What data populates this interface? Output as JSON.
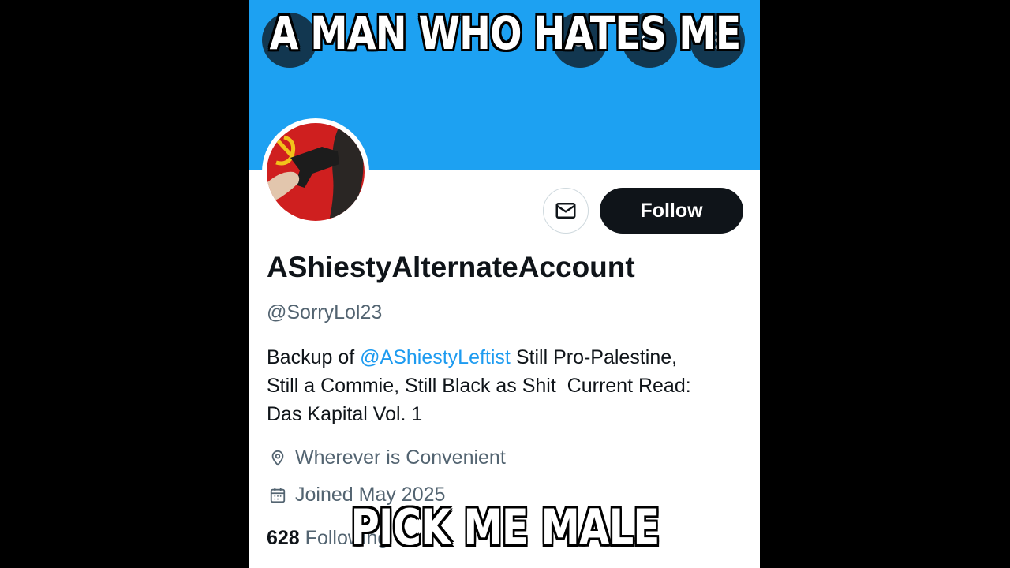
{
  "captions": {
    "top": "A MAN WHO HATES ME",
    "bottom": "PICK ME MALE"
  },
  "profile": {
    "display_name": "AShiestyAlternateAccount",
    "handle": "@SorryLol23",
    "bio": {
      "prefix": "Backup of ",
      "mention": "@AShiestyLeftist",
      "line1_rest": " Still Pro-Palestine,",
      "line2": "Still a Commie, Still Black as Shit  Current Read:",
      "line3": "Das Kapital Vol. 1"
    },
    "location": "Wherever is Convenient",
    "joined": "Joined May 2025",
    "following_count": "628",
    "following_label": "Following"
  },
  "actions": {
    "follow_label": "Follow"
  },
  "icons": {
    "back": "arrow-left-icon",
    "search": "search-icon",
    "refresh": "refresh-icon",
    "more": "more-vertical-icon",
    "message": "envelope-icon",
    "location": "location-pin-icon",
    "calendar": "calendar-icon"
  },
  "colors": {
    "banner": "#1da1f2",
    "accent": "#1d9bf0",
    "follow_bg": "#0f1419",
    "muted": "#536471"
  }
}
